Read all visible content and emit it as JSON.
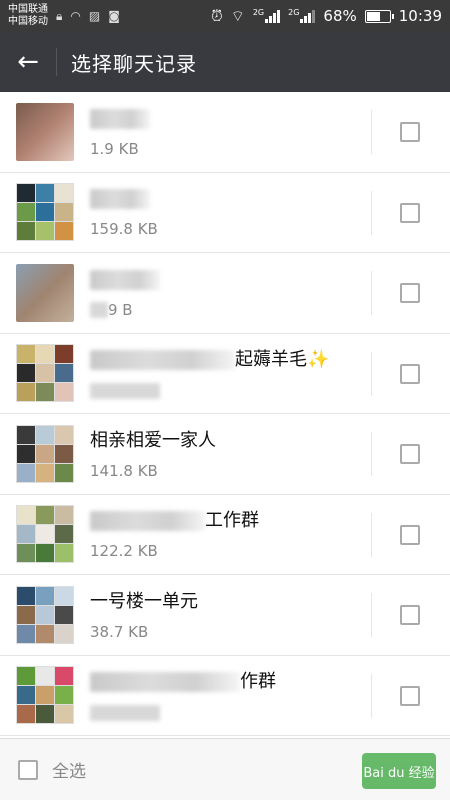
{
  "status_bar": {
    "carrier_1": "中国联通",
    "carrier_2": "中国移动",
    "network_1": "2G",
    "network_2": "2G",
    "battery_percent": "68%",
    "battery_level": 0.68,
    "time": "10:39"
  },
  "header": {
    "title": "选择聊天记录"
  },
  "chats": [
    {
      "name_visible": "",
      "size": "1.9 KB",
      "avatar": "single",
      "colors": [
        "#7a5b4d",
        "#b08272",
        "#e4c7bb"
      ]
    },
    {
      "name_visible": "",
      "size": "159.8 KB",
      "avatar": "grid",
      "colors": [
        "#1f2a33",
        "#3e7fa8",
        "#e8e2d2",
        "#6b9a48",
        "#2c6f9a",
        "#c9b48a",
        "#5e7d3b",
        "#a7c06a",
        "#d29243"
      ]
    },
    {
      "name_visible": "",
      "size": "9 B",
      "avatar": "single",
      "colors": [
        "#8a9fb2",
        "#9f8470",
        "#c4b09d"
      ]
    },
    {
      "name_visible": "起薅羊毛✨",
      "size": "",
      "avatar": "grid",
      "colors": [
        "#c9b26a",
        "#e6d7b5",
        "#7c3d2a",
        "#2a2a2a",
        "#d7c2a5",
        "#4a6c8c",
        "#b9a15c",
        "#7d8b5a",
        "#e2c3b8"
      ]
    },
    {
      "name_visible": "相亲相爱一家人",
      "size": "141.8 KB",
      "avatar": "grid",
      "colors": [
        "#3a3a3a",
        "#b9cbd6",
        "#d9c7b0",
        "#2e2e2e",
        "#c9a684",
        "#7b5b45",
        "#9ab0c8",
        "#d6b37e",
        "#6b8a4a"
      ]
    },
    {
      "name_visible": "工作群",
      "size": "122.2 KB",
      "avatar": "grid",
      "colors": [
        "#e7e2c9",
        "#8a9a5d",
        "#c9bca3",
        "#a4b8c8",
        "#efe9e4",
        "#5d6a4a",
        "#6e8f5a",
        "#4a7a3a",
        "#9cc06a"
      ]
    },
    {
      "name_visible": "一号楼一单元",
      "size": "38.7 KB",
      "avatar": "grid",
      "colors": [
        "#2c4c6c",
        "#7aa0c0",
        "#cbd8e6",
        "#8a6a4a",
        "#b7c9d8",
        "#4a4a4a",
        "#6f8aa8",
        "#b08a6a",
        "#d9d3cc"
      ]
    },
    {
      "name_visible": "作群",
      "size": "",
      "avatar": "grid",
      "colors": [
        "#5e9a3a",
        "#e8e8e8",
        "#d94a6a",
        "#3a6a8a",
        "#c9a06a",
        "#7ab04a",
        "#a86a4a",
        "#4a5a3a",
        "#d8c8a8"
      ]
    }
  ],
  "footer": {
    "select_all_label": "全选",
    "watermark": "Bai du 经验"
  },
  "colors": {
    "header_bg": "#393a3f",
    "status_bg": "#3a3a3a",
    "checkbox_border": "#aaaaaa"
  }
}
